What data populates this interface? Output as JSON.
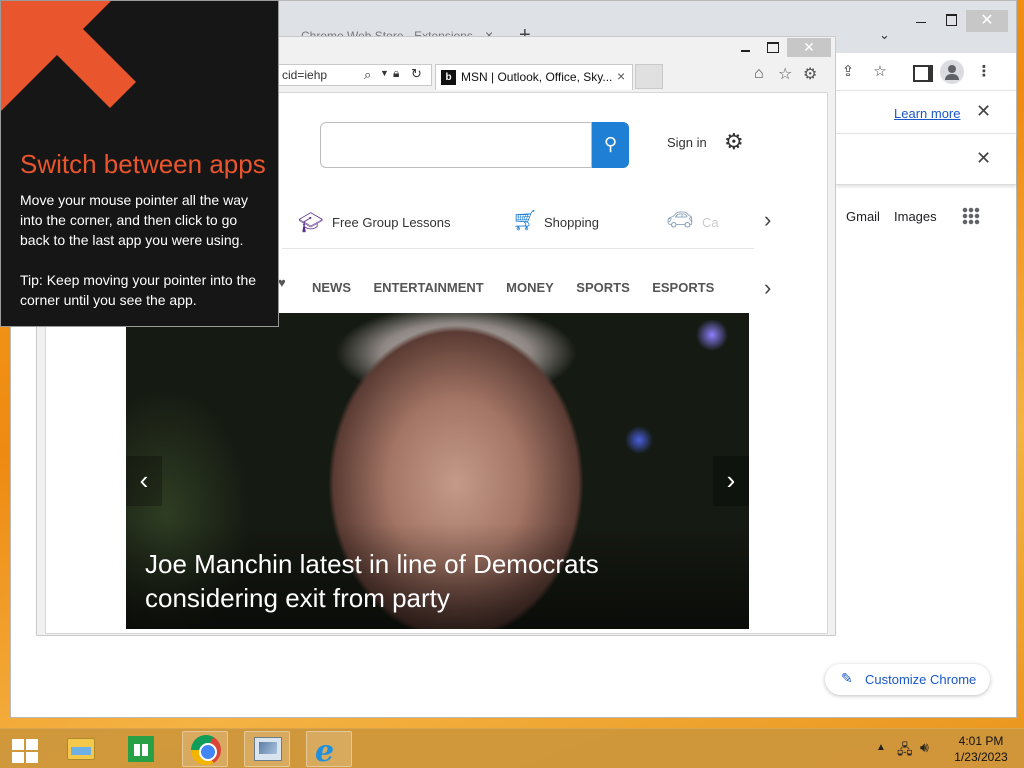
{
  "chrome": {
    "tab_title": "Chrome Web Store - Extensions",
    "tab_close": "×",
    "new_tab": "+",
    "window_close": "✕",
    "tablist_chevron": "⌄",
    "infobar_learn_more": "Learn more",
    "infobar_close": "✕",
    "gmail": "Gmail",
    "images": "Images",
    "customize_label": "Customize Chrome",
    "icons": {
      "share": "share-icon",
      "star": "star-icon",
      "menu": "⋮"
    }
  },
  "ie": {
    "address_text": "cid=iehp",
    "tab_title": "MSN | Outlook, Office, Sky...",
    "tab_close": "×",
    "favicon_letter": "b",
    "window_close": "✕",
    "msn": {
      "sign_in": "Sign in",
      "quick_links": [
        {
          "label": "Free Group Lessons",
          "icon": "graduation-cap-icon"
        },
        {
          "label": "Shopping",
          "icon": "shopping-cart-icon"
        },
        {
          "label": "Ca",
          "icon": "car-icon"
        }
      ],
      "nav_partial": "♥",
      "nav": [
        "NEWS",
        "ENTERTAINMENT",
        "MONEY",
        "SPORTS",
        "ESPORTS"
      ],
      "hero_headline": "Joe Manchin latest in line of Democrats considering exit from party"
    }
  },
  "tip": {
    "title": "Switch between apps",
    "body": "Move your mouse pointer all the way into the corner, and then click to go back to the last app you were using.",
    "tip": "Tip: Keep moving your pointer into the corner until you see the app.",
    "accent_color": "#e9552d"
  },
  "taskbar": {
    "time": "4:01 PM",
    "date": "1/23/2023"
  }
}
